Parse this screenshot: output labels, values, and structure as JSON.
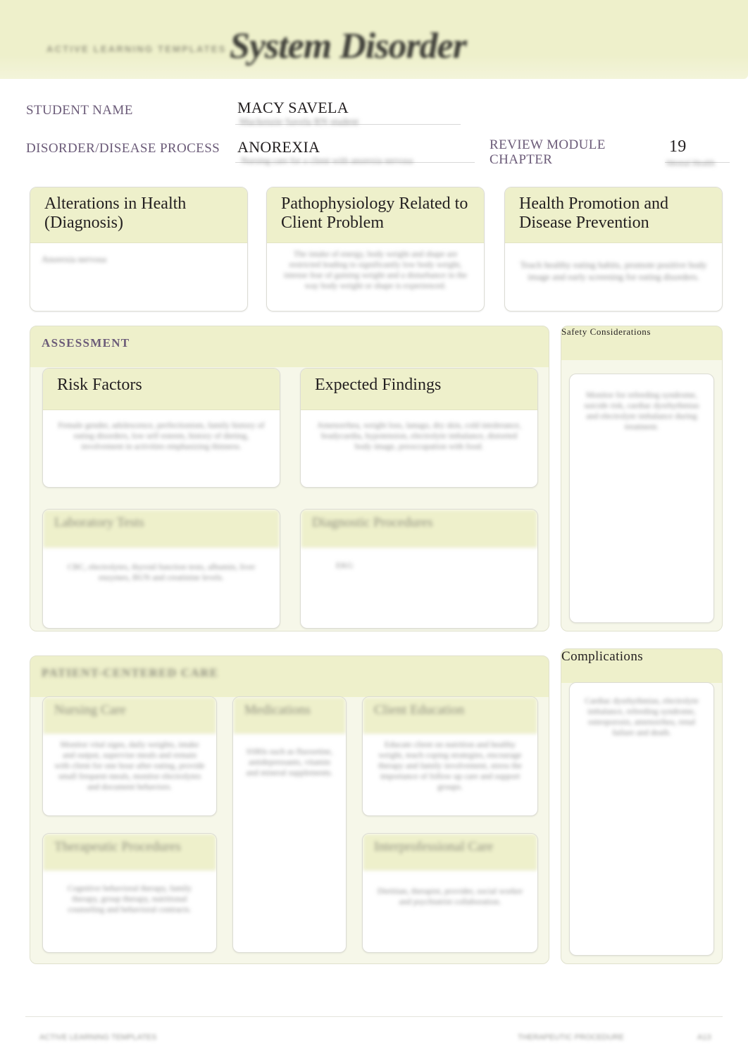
{
  "header": {
    "brand": "ACTIVE LEARNING TEMPLATES",
    "title": "System Disorder"
  },
  "fields": {
    "student_name_label": "STUDENT NAME",
    "student_name_value": "MACY SAVELA",
    "student_name_sub": "Mackenzie Savela RN student",
    "disorder_label": "DISORDER/DISEASE PROCESS",
    "disorder_value": "ANOREXIA",
    "disorder_sub": "Nursing care for a client with anorexia nervosa",
    "review_module_label": "REVIEW MODULE CHAPTER",
    "review_module_value": "19",
    "review_module_sub": "Mental Health"
  },
  "top_boxes": [
    {
      "title": "Alterations in Health (Diagnosis)",
      "body": "Anorexia nervosa"
    },
    {
      "title": "Pathophysiology Related to Client Problem",
      "body": "The intake of energy, body weight and shape are restricted leading to significantly low body weight, intense fear of gaining weight and a disturbance in the way body weight or shape is experienced."
    },
    {
      "title": "Health Promotion and Disease Prevention",
      "body": "Teach healthy eating habits, promote positive body image and early screening for eating disorders."
    }
  ],
  "assessment": {
    "section_title": "ASSESSMENT",
    "risk_factors": {
      "title": "Risk Factors",
      "body": "Female gender, adolescence, perfectionism, family history of eating disorders, low self esteem, history of dieting, involvement in activities emphasizing thinness."
    },
    "expected_findings": {
      "title": "Expected Findings",
      "body": "Amenorrhea, weight loss, lanugo, dry skin, cold intolerance, bradycardia, hypotension, electrolyte imbalance, distorted body image, preoccupation with food."
    },
    "laboratory_tests": {
      "title": "Laboratory Tests",
      "body": "CBC, electrolytes, thyroid function tests, albumin, liver enzymes, BUN and creatinine levels."
    },
    "diagnostic_procedures": {
      "title": "Diagnostic Procedures",
      "body": "EKG"
    },
    "safety": {
      "title": "Safety Considerations",
      "body": "Monitor for refeeding syndrome, suicide risk, cardiac dysrhythmias and electrolyte imbalance during treatment."
    }
  },
  "patient_centered_care": {
    "section_title": "PATIENT-CENTERED CARE",
    "nursing_care": {
      "title": "Nursing Care",
      "body": "Monitor vital signs, daily weights, intake and output, supervise meals and remain with client for one hour after eating, provide small frequent meals, monitor electrolytes and document behaviors."
    },
    "medications": {
      "title": "Medications",
      "body": "SSRIs such as fluoxetine, antidepressants, vitamin and mineral supplements."
    },
    "client_education": {
      "title": "Client Education",
      "body": "Educate client on nutrition and healthy weight, teach coping strategies, encourage therapy and family involvement, stress the importance of follow up care and support groups."
    },
    "therapeutic_procedures": {
      "title": "Therapeutic Procedures",
      "body": "Cognitive behavioral therapy, family therapy, group therapy, nutritional counseling and behavioral contracts."
    },
    "interprofessional_care": {
      "title": "Interprofessional Care",
      "body": "Dietitian, therapist, provider, social worker and psychiatrist collaboration."
    }
  },
  "complications": {
    "title": "Complications",
    "body": "Cardiac dysrhythmias, electrolyte imbalance, refeeding syndrome, osteoporosis, amenorrhea, renal failure and death."
  },
  "footer": {
    "left": "ACTIVE LEARNING TEMPLATES",
    "right": "THERAPEUTIC PROCEDURE",
    "page": "A13"
  },
  "colors": {
    "banner": "#eef0cb",
    "label_purple": "#6b5b78",
    "card_border": "#dcdcd4"
  }
}
